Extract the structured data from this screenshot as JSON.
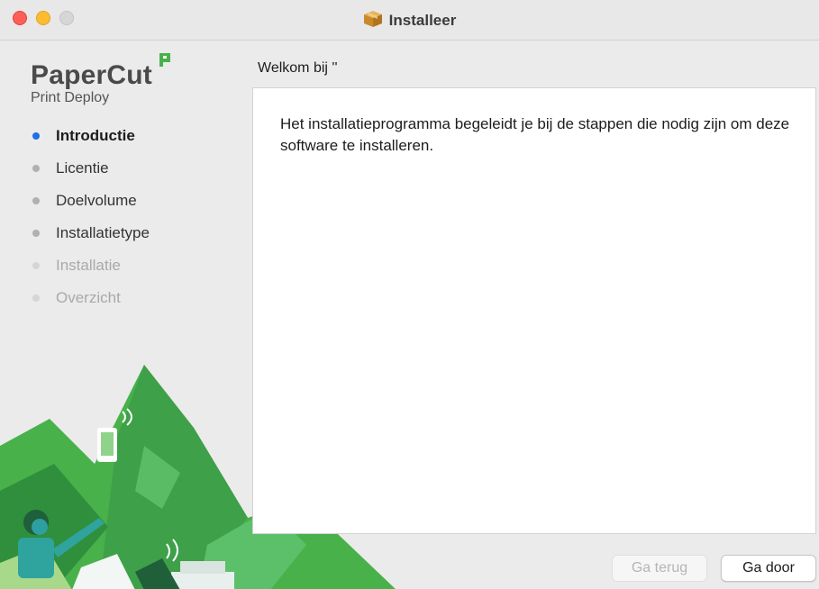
{
  "window": {
    "title": "Installeer",
    "icon": "package-icon"
  },
  "brand": {
    "name": "PaperCut",
    "product": "Print Deploy",
    "accent": "#48b14a"
  },
  "steps": [
    {
      "label": "Introductie",
      "state": "active"
    },
    {
      "label": "Licentie",
      "state": "pending"
    },
    {
      "label": "Doelvolume",
      "state": "pending"
    },
    {
      "label": "Installatietype",
      "state": "pending"
    },
    {
      "label": "Installatie",
      "state": "disabled"
    },
    {
      "label": "Overzicht",
      "state": "disabled"
    }
  ],
  "main": {
    "heading": "Welkom bij ''",
    "body": "Het installatieprogramma begeleidt je bij de stappen die nodig zijn om deze software te installeren."
  },
  "buttons": {
    "back_label": "Ga terug",
    "next_label": "Ga door"
  },
  "colors": {
    "active_step": "#1f6fe5",
    "close": "#ff5f57",
    "minimize": "#febc2e"
  }
}
